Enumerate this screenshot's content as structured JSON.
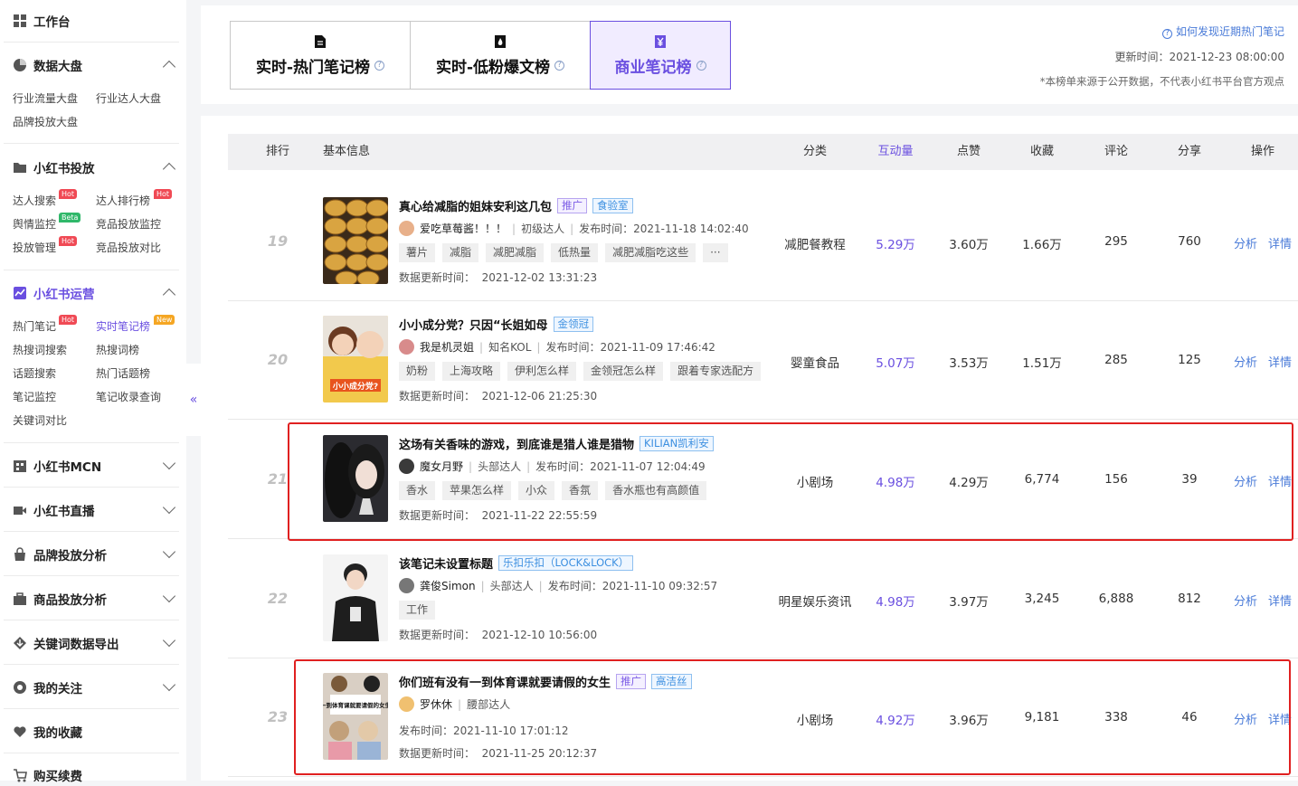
{
  "sidebar": {
    "workbench": "工作台",
    "data_dashboard": {
      "title": "数据大盘",
      "items": [
        "行业流量大盘",
        "行业达人大盘",
        "品牌投放大盘"
      ]
    },
    "xhs_placement": {
      "title": "小红书投放",
      "items": [
        "达人搜索",
        "达人排行榜",
        "舆情监控",
        "竞品投放监控",
        "投放管理",
        "竞品投放对比"
      ],
      "tags": {
        "hot": "Hot",
        "beta": "Beta"
      }
    },
    "xhs_ops": {
      "title": "小红书运营",
      "items": [
        "热门笔记",
        "实时笔记榜",
        "热搜词搜索",
        "热搜词榜",
        "话题搜索",
        "热门话题榜",
        "笔记监控",
        "笔记收录查询",
        "关键词对比"
      ],
      "tags": {
        "hot": "Hot",
        "new": "New"
      }
    },
    "sections": [
      "小红书MCN",
      "小红书直播",
      "品牌投放分析",
      "商品投放分析",
      "关键词数据导出",
      "我的关注",
      "我的收藏",
      "购买续费"
    ],
    "collapse_glyph": "«"
  },
  "tabs": [
    {
      "label": "实时-热门笔记榜",
      "active": false,
      "icon": "document-icon"
    },
    {
      "label": "实时-低粉爆文榜",
      "active": false,
      "icon": "flame-icon"
    },
    {
      "label": "商业笔记榜",
      "active": true,
      "icon": "yuan-icon"
    }
  ],
  "header": {
    "help_link": "如何发现近期热门笔记",
    "update_label": "更新时间：",
    "update_time": "2021-12-23 08:00:00",
    "disclaimer": "*本榜单来源于公开数据，不代表小红书平台官方观点"
  },
  "columns": [
    "排行",
    "基本信息",
    "分类",
    "互动量",
    "点赞",
    "收藏",
    "评论",
    "分享",
    "操作"
  ],
  "actions": {
    "analyze": "分析",
    "detail": "详情"
  },
  "labels": {
    "publish": "发布时间：",
    "data_update": "数据更新时间："
  },
  "rows": [
    {
      "rank": "19",
      "title": "真心给减脂的姐妹安利这几包",
      "tags": [
        {
          "text": "推广",
          "kind": "p"
        },
        {
          "text": "食验室",
          "kind": "b"
        }
      ],
      "author": "爱吃草莓酱！！！",
      "level": "初级达人",
      "publish": "2021-11-18 14:02:40",
      "chips": [
        "薯片",
        "减脂",
        "减肥减脂",
        "低热量",
        "减肥减脂吃这些",
        "···"
      ],
      "data_update": "2021-12-02 13:31:23",
      "category": "减肥餐教程",
      "interactions": "5.29万",
      "likes": "3.60万",
      "favorites": "1.66万",
      "comments": "295",
      "shares": "760"
    },
    {
      "rank": "20",
      "title": "小小成分党？只因“长姐如母",
      "tags": [
        {
          "text": "金领冠",
          "kind": "b"
        }
      ],
      "author": "我是机灵姐",
      "level": "知名KOL",
      "publish": "2021-11-09 17:46:42",
      "chips": [
        "奶粉",
        "上海攻略",
        "伊利怎么样",
        "金领冠怎么样",
        "跟着专家选配方"
      ],
      "data_update": "2021-12-06 21:25:30",
      "category": "婴童食品",
      "interactions": "5.07万",
      "likes": "3.53万",
      "favorites": "1.51万",
      "comments": "285",
      "shares": "125"
    },
    {
      "rank": "21",
      "title": "这场有关香味的游戏，到底谁是猎人谁是猎物",
      "tags": [
        {
          "text": "KILIAN凯利安",
          "kind": "b"
        }
      ],
      "author": "魔女月野",
      "level": "头部达人",
      "publish": "2021-11-07 12:04:49",
      "chips": [
        "香水",
        "苹果怎么样",
        "小众",
        "香氛",
        "香水瓶也有高颜值"
      ],
      "data_update": "2021-11-22 22:55:59",
      "category": "小剧场",
      "interactions": "4.98万",
      "likes": "4.29万",
      "favorites": "6,774",
      "comments": "156",
      "shares": "39"
    },
    {
      "rank": "22",
      "title": "该笔记未设置标题",
      "tags": [
        {
          "text": "乐扣乐扣（LOCK&LOCK）",
          "kind": "b"
        }
      ],
      "author": "龚俊Simon",
      "level": "头部达人",
      "publish": "2021-11-10 09:32:57",
      "chips": [
        "工作"
      ],
      "data_update": "2021-12-10 10:56:00",
      "category": "明星娱乐资讯",
      "interactions": "4.98万",
      "likes": "3.97万",
      "favorites": "3,245",
      "comments": "6,888",
      "shares": "812"
    },
    {
      "rank": "23",
      "title": "你们班有没有一到体育课就要请假的女生",
      "tags": [
        {
          "text": "推广",
          "kind": "p"
        },
        {
          "text": "高洁丝",
          "kind": "b"
        }
      ],
      "author": "罗休休",
      "level": "腰部达人",
      "publish": "2021-11-10 17:01:12",
      "chips": [],
      "data_update": "2021-11-25 20:12:37",
      "category": "小剧场",
      "interactions": "4.92万",
      "likes": "3.96万",
      "favorites": "9,181",
      "comments": "338",
      "shares": "46"
    }
  ],
  "thumb_text": {
    "r20": "小小成分党?",
    "r23": "一到体育课就要请假的女生"
  },
  "colors": {
    "accent": "#6a4fe0",
    "link": "#4a7bd8",
    "highlight": "#e02020"
  }
}
